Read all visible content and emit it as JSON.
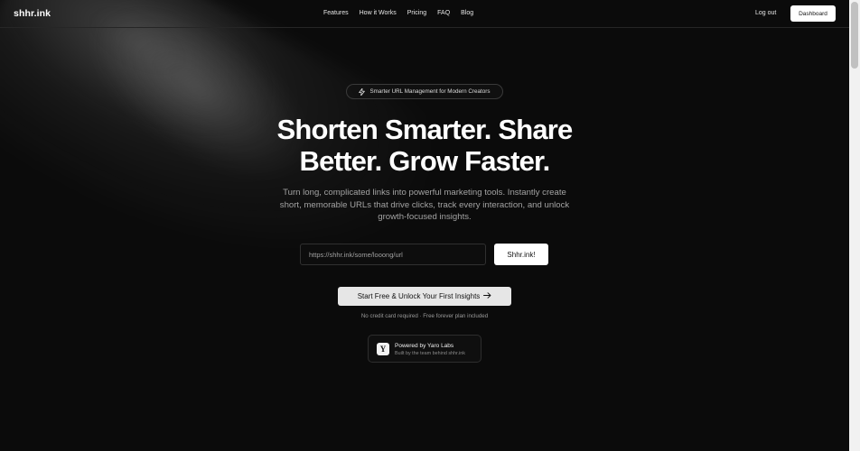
{
  "header": {
    "logo": "shhr.ink",
    "nav": [
      "Features",
      "How it Works",
      "Pricing",
      "FAQ",
      "Blog"
    ],
    "logout_label": "Log out",
    "dashboard_label": "Dashboard"
  },
  "hero": {
    "badge_icon": "lightning-icon",
    "badge_text": "Smarter URL Management for Modern Creators",
    "headline_line1": "Shorten Smarter. Share",
    "headline_line2": "Better. Grow Faster.",
    "subtitle": "Turn long, complicated links into powerful marketing tools. Instantly create short, memorable URLs that drive clicks, track every interaction, and unlock growth-focused insights.",
    "url_placeholder": "https://shhr.ink/some/looong/url",
    "shorten_label": "Shhr.ink!",
    "cta_label": "Start Free & Unlock Your First Insights",
    "cta_icon": "arrow-right-icon",
    "note": "No credit card required · Free forever plan included"
  },
  "powered": {
    "logo_letter": "Y",
    "title": "Powered by Yaro Labs",
    "subtitle": "Built by the team behind shhr.ink"
  },
  "colors": {
    "background": "#0b0b0b",
    "accent": "#ffffff",
    "muted_text": "#a3a3a3"
  }
}
